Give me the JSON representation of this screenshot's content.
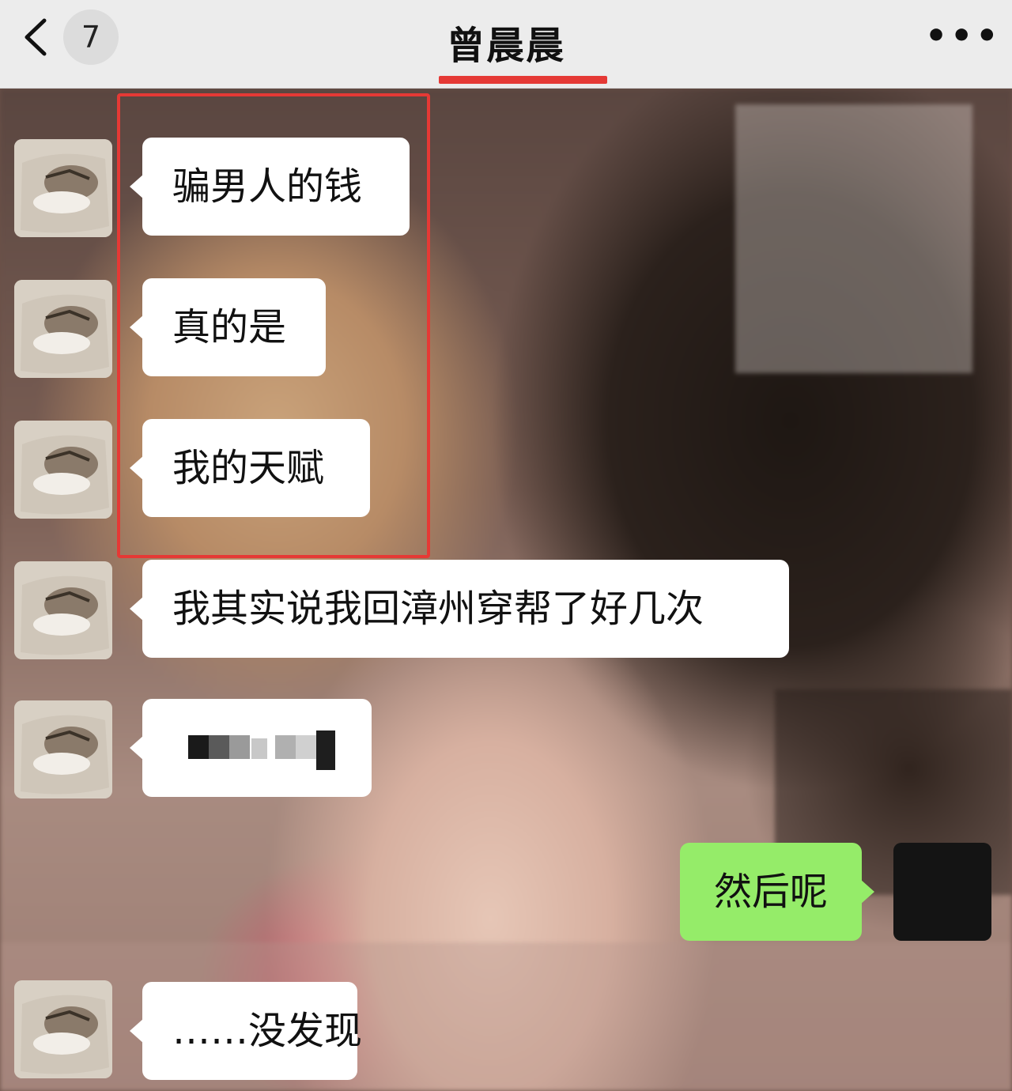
{
  "header": {
    "back_icon": "chevron-left-icon",
    "unread_count": "7",
    "title": "曾晨晨",
    "more_icon": "more-icon",
    "more_label": "•••"
  },
  "messages": [
    {
      "from": "other",
      "text": "骗男人的钱"
    },
    {
      "from": "other",
      "text": "真的是"
    },
    {
      "from": "other",
      "text": "我的天赋"
    },
    {
      "from": "other",
      "text": "我其实说我回漳州穿帮了好几次"
    },
    {
      "from": "other",
      "text": ""
    },
    {
      "from": "self",
      "text": "然后呢"
    },
    {
      "from": "other",
      "text": "……没发现"
    }
  ],
  "colors": {
    "accent_red": "#e53935",
    "self_bubble": "#95ec69",
    "other_bubble": "#ffffff",
    "header_bg": "#ececec"
  }
}
